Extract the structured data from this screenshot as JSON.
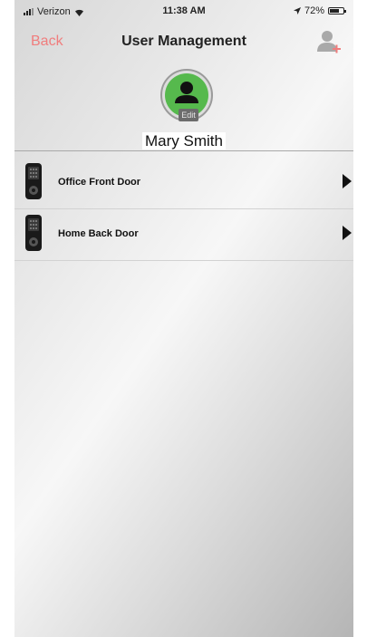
{
  "status_bar": {
    "carrier": "Verizon",
    "time": "11:38 AM",
    "battery_percent": "72%",
    "battery_level": 0.72
  },
  "nav": {
    "back_label": "Back",
    "title": "User Management",
    "add_user_icon": "add-user-icon"
  },
  "profile": {
    "avatar_icon": "person-icon",
    "avatar_color": "#56b94d",
    "edit_label": "Edit",
    "name": "Mary Smith"
  },
  "doors": [
    {
      "label": "Office Front Door",
      "icon": "door-lock-icon"
    },
    {
      "label": "Home Back Door",
      "icon": "door-lock-icon"
    }
  ],
  "colors": {
    "accent": "#f07d7d",
    "text": "#111111"
  }
}
